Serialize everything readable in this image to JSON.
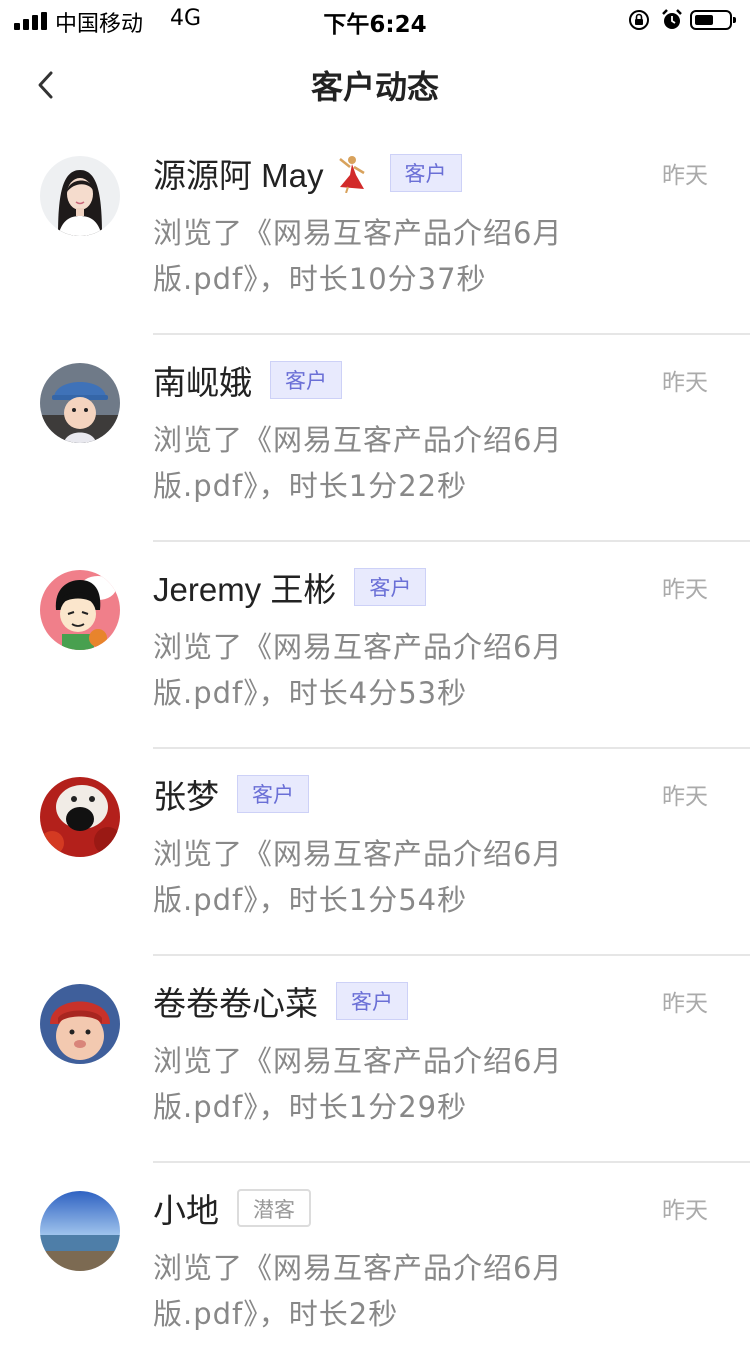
{
  "status_bar": {
    "carrier": "中国移动",
    "network": "4G",
    "time": "下午6:24"
  },
  "nav": {
    "title": "客户动态"
  },
  "items": [
    {
      "name": "源源阿 May",
      "tag": "客户",
      "tag_type": "customer",
      "time": "昨天",
      "desc_line1": "浏览了《网易互客产品介绍6月",
      "desc_line2": "版.pdf》，时长10分37秒",
      "avatar": "woman-portrait",
      "has_emoji": true
    },
    {
      "name": "南岘娥",
      "tag": "客户",
      "tag_type": "customer",
      "time": "昨天",
      "desc_line1": "浏览了《网易互客产品介绍6月",
      "desc_line2": "版.pdf》，时长1分22秒",
      "avatar": "baby-hat"
    },
    {
      "name": "Jeremy 王彬",
      "tag": "客户",
      "tag_type": "customer",
      "time": "昨天",
      "desc_line1": "浏览了《网易互客产品介绍6月",
      "desc_line2": "版.pdf》，时长4分53秒",
      "avatar": "cartoon-boy"
    },
    {
      "name": "张梦",
      "tag": "客户",
      "tag_type": "customer",
      "time": "昨天",
      "desc_line1": "浏览了《网易互客产品介绍6月",
      "desc_line2": "版.pdf》，时长1分54秒",
      "avatar": "dog-nose"
    },
    {
      "name": "卷卷卷心菜",
      "tag": "客户",
      "tag_type": "customer",
      "time": "昨天",
      "desc_line1": "浏览了《网易互客产品介绍6月",
      "desc_line2": "版.pdf》，时长1分29秒",
      "avatar": "child-red-hat"
    },
    {
      "name": "小地",
      "tag": "潜客",
      "tag_type": "prospect",
      "time": "昨天",
      "desc_line1": "浏览了《网易互客产品介绍6月",
      "desc_line2": "版.pdf》，时长2秒",
      "avatar": "sea-horizon"
    }
  ]
}
